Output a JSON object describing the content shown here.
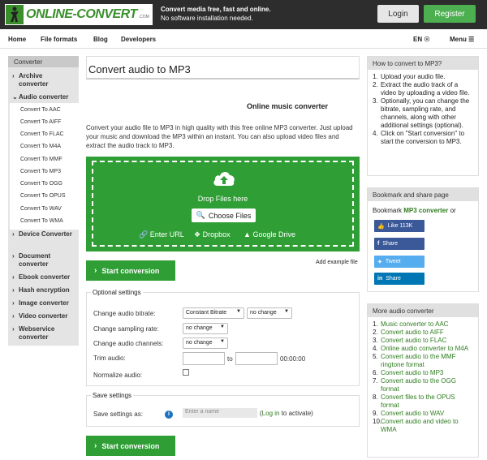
{
  "header": {
    "logo_word_a": "ONLINE-CO",
    "logo_word_b": "NVERT",
    "logo_suffix": ".COM",
    "tagline_bold": "Convert media free, fast and online.",
    "tagline_sub": "No software installation needed.",
    "login": "Login",
    "register": "Register"
  },
  "nav": {
    "items": [
      "Home",
      "File formats",
      "Blog",
      "Developers"
    ],
    "lang": "EN",
    "menu": "Menu"
  },
  "sidebar": {
    "title": "Converter",
    "categories": [
      {
        "label": "Archive converter"
      },
      {
        "label": "Audio converter"
      },
      {
        "label": "Device Converter"
      },
      {
        "label": "Document converter"
      },
      {
        "label": "Ebook converter"
      },
      {
        "label": "Hash encryption"
      },
      {
        "label": "Image converter"
      },
      {
        "label": "Video converter"
      },
      {
        "label": "Webservice converter"
      }
    ],
    "audio_items": [
      "Convert To AAC",
      "Convert To AIFF",
      "Convert To FLAC",
      "Convert To M4A",
      "Convert To MMF",
      "Convert To MP3",
      "Convert To OGG",
      "Convert To OPUS",
      "Convert To WAV",
      "Convert To WMA"
    ]
  },
  "main": {
    "title": "Convert audio to MP3",
    "subtitle": "Online music converter",
    "description": "Convert your audio file to MP3 in high quality with this free online MP3 converter. Just upload your music and download the MP3 within an instant. You can also upload video files and extract the audio track to MP3.",
    "drop_text": "Drop Files here",
    "choose_files": "Choose Files",
    "sources": [
      "Enter URL",
      "Dropbox",
      "Google Drive"
    ],
    "start_conversion": "Start conversion",
    "add_example": "Add example file",
    "optional_settings": {
      "legend": "Optional settings",
      "bitrate_label": "Change audio bitrate:",
      "bitrate_value": "Constant Bitrate",
      "bitrate_value2": "no change",
      "sampling_label": "Change sampling rate:",
      "sampling_value": "no change",
      "channels_label": "Change audio channels:",
      "channels_value": "no change",
      "trim_label": "Trim audio:",
      "trim_to": "to",
      "trim_time": "00:00:00",
      "normalize_label": "Normalize audio:"
    },
    "save_settings": {
      "legend": "Save settings",
      "label": "Save settings as:",
      "placeholder": "Enter a name",
      "login_open": "(",
      "login_link": "Log in",
      "login_close": " to activate)"
    }
  },
  "how_to": {
    "title": "How to convert to MP3?",
    "steps": [
      "Upload your audio file.",
      "Extract the audio track of a video by uploading a video file.",
      "Optionally, you can change the bitrate, sampling rate, and channels, along with other additional settings (optional).",
      "Click on \"Start conversion\" to start the conversion to MP3."
    ]
  },
  "bookmark": {
    "title": "Bookmark and share page",
    "text_a": "Bookmark ",
    "text_link": "MP3 converter",
    "text_b": " or",
    "like": "Like 113K",
    "share_fb": "Share",
    "tweet": "Tweet",
    "share_in": "Share"
  },
  "more": {
    "title": "More audio converter",
    "items": [
      "Music converter to AAC",
      "Convert audio to AIFF",
      "Convert audio to FLAC",
      "Online audio converter to M4A",
      "Convert audio to the MMF ringtone format",
      "Convert audio to MP3",
      "Convert audio to the OGG format",
      "Convert files to the OPUS format",
      "Convert audio to WAV",
      "Convert audio and video to WMA"
    ]
  },
  "colors": {
    "brand_green": "#2e9e35",
    "link_green": "#2e7d1f",
    "header_bg": "#2d2d2d",
    "facebook": "#3b5998",
    "twitter": "#55acee",
    "linkedin": "#0077b5"
  }
}
